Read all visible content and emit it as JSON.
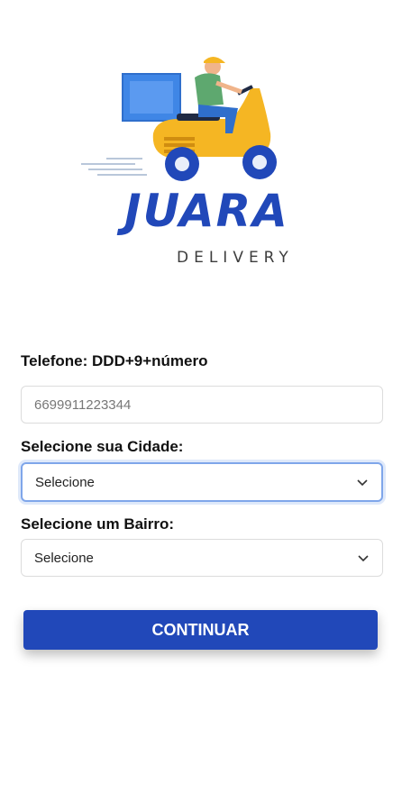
{
  "brand": {
    "name": "JUARA",
    "tagline": "DELIVERY"
  },
  "form": {
    "phone_label": "Telefone: DDD+9+número",
    "phone_placeholder": "6699911223344",
    "city_label": "Selecione sua Cidade:",
    "city_selected": "Selecione",
    "district_label": "Selecione um Bairro:",
    "district_selected": "Selecione",
    "continue_label": "CONTINUAR"
  },
  "colors": {
    "primary": "#2148b9",
    "scooter": "#f5b623",
    "box": "#3f86e6",
    "focus": "#7fa6ea"
  },
  "icons": [
    "delivery-scooter-icon",
    "chevron-down-icon"
  ]
}
